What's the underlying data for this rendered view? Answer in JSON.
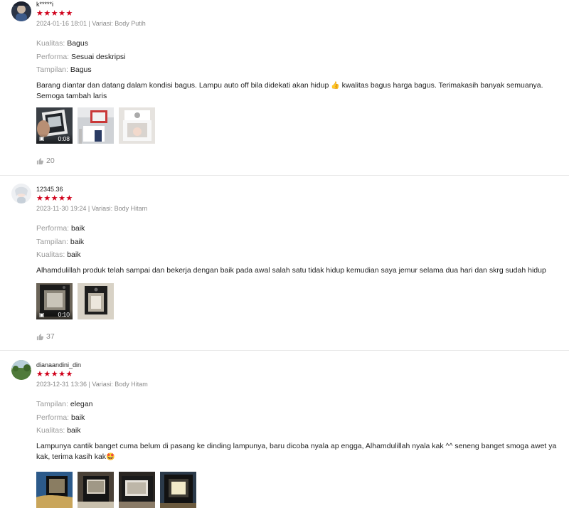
{
  "reviews": [
    {
      "username": "k*****i",
      "stars": "★★★★★",
      "meta": "2024-01-16 18:01 | Variasi: Body Putih",
      "attrs": [
        {
          "label": "Kualitas:",
          "value": "Bagus"
        },
        {
          "label": "Performa:",
          "value": "Sesuai deskripsi"
        },
        {
          "label": "Tampilan:",
          "value": "Bagus"
        }
      ],
      "text": "Barang diantar dan datang dalam kondisi bagus. Lampu auto off bila didekati akan hidup",
      "emoji": "👍",
      "text_after": " kwalitas bagus harga bagus. Terimakasih banyak semuanya. Semoga tambah laris",
      "video_duration": "0:08",
      "likes": "20"
    },
    {
      "username": "12345.36",
      "stars": "★★★★★",
      "meta": "2023-11-30 19:24 | Variasi: Body Hitam",
      "attrs": [
        {
          "label": "Performa:",
          "value": "baik"
        },
        {
          "label": "Tampilan:",
          "value": "baik"
        },
        {
          "label": "Kualitas:",
          "value": "baik"
        }
      ],
      "text": "Alhamdulillah produk telah sampai dan bekerja dengan baik pada awal salah satu tidak hidup kemudian saya jemur selama dua hari dan skrg sudah hidup",
      "video_duration": "0:10",
      "likes": "37"
    },
    {
      "username": "dianaandini_din",
      "stars": "★★★★★",
      "meta": "2023-12-31 13:36 | Variasi: Body Hitam",
      "attrs": [
        {
          "label": "Tampilan:",
          "value": "elegan"
        },
        {
          "label": "Performa:",
          "value": "baik"
        },
        {
          "label": "Kualitas:",
          "value": "baik"
        }
      ],
      "text": "Lampunya cantik banget cuma belum di pasang ke dinding lampunya, baru dicoba nyala ap engga, Alhamdulillah nyala kak ^^ seneng banget smoga awet ya kak, terima kasih kak",
      "emoji": "🤩"
    }
  ],
  "icons": {
    "like": "thumbs-up-icon",
    "video": "video-camera-icon"
  },
  "colors": {
    "star": "#d0011b",
    "muted": "#8a8a8a"
  }
}
